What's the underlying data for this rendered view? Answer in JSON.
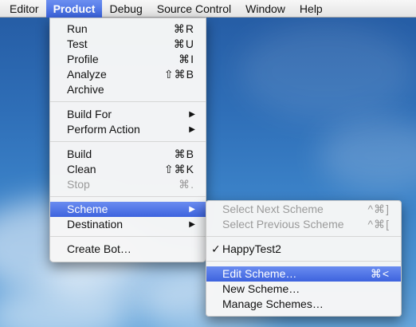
{
  "menubar": {
    "items": [
      "Editor",
      "Product",
      "Debug",
      "Source Control",
      "Window",
      "Help"
    ]
  },
  "product_menu": {
    "run": {
      "label": "Run",
      "shortcut": "⌘R"
    },
    "test": {
      "label": "Test",
      "shortcut": "⌘U"
    },
    "profile": {
      "label": "Profile",
      "shortcut": "⌘I"
    },
    "analyze": {
      "label": "Analyze",
      "shortcut": "⇧⌘B"
    },
    "archive": {
      "label": "Archive"
    },
    "build_for": {
      "label": "Build For",
      "arrow": "▶"
    },
    "perform_action": {
      "label": "Perform Action",
      "arrow": "▶"
    },
    "build": {
      "label": "Build",
      "shortcut": "⌘B"
    },
    "clean": {
      "label": "Clean",
      "shortcut": "⇧⌘K"
    },
    "stop": {
      "label": "Stop",
      "shortcut": "⌘."
    },
    "scheme": {
      "label": "Scheme",
      "arrow": "▶"
    },
    "destination": {
      "label": "Destination",
      "arrow": "▶"
    },
    "create_bot": {
      "label": "Create Bot…"
    }
  },
  "scheme_menu": {
    "select_next": {
      "label": "Select Next Scheme",
      "shortcut": "^⌘]"
    },
    "select_previous": {
      "label": "Select Previous Scheme",
      "shortcut": "^⌘["
    },
    "current_scheme": {
      "label": "HappyTest2",
      "check": "✓"
    },
    "edit_scheme": {
      "label": "Edit Scheme…",
      "shortcut": "⌘<"
    },
    "new_scheme": {
      "label": "New Scheme…"
    },
    "manage_schemes": {
      "label": "Manage Schemes…"
    }
  },
  "colors": {
    "highlight": "#3d63de",
    "wallpaper": "#2f6fb8"
  }
}
